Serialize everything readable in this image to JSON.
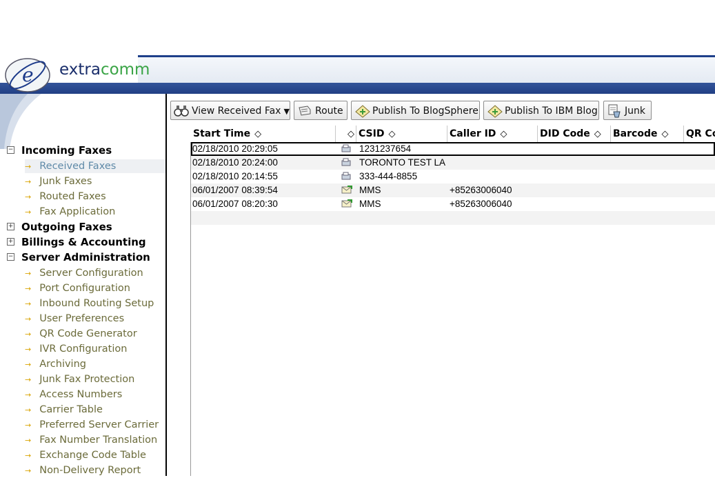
{
  "brand": {
    "part1": "extra",
    "part2": "comm"
  },
  "toolbar": {
    "view_label": "View Received Fax",
    "route_label": "Route",
    "blogsphere_label": "Publish To BlogSphere",
    "ibm_blog_label": "Publish To IBM Blog",
    "junk_label": "Junk"
  },
  "nav": {
    "incoming": {
      "label": "Incoming Faxes",
      "toggle": "−",
      "items": [
        "Received Faxes",
        "Junk Faxes",
        "Routed Faxes",
        "Fax Application"
      ]
    },
    "outgoing": {
      "label": "Outgoing Faxes",
      "toggle": "+"
    },
    "billings": {
      "label": "Billings & Accounting",
      "toggle": "+"
    },
    "server": {
      "label": "Server Administration",
      "toggle": "−",
      "items": [
        "Server Configuration",
        "Port Configuration",
        "Inbound Routing Setup",
        "User Preferences",
        "QR Code Generator",
        "IVR Configuration",
        "Archiving",
        "Junk Fax Protection",
        "Access Numbers",
        "Carrier Table",
        "Preferred Server Carrier",
        "Fax Number Translation",
        "Exchange Code Table",
        "Non-Delivery Report"
      ]
    },
    "arrow": "→",
    "active_item": "Received Faxes"
  },
  "grid": {
    "sort_glyph": "◇",
    "columns": [
      "Start Time",
      "CSID",
      "Caller ID",
      "DID Code",
      "Barcode",
      "QR Co"
    ],
    "rows": [
      {
        "start_time": "02/18/2010 20:29:05",
        "icon": "fax-icon",
        "csid": "1231237654",
        "caller_id": ""
      },
      {
        "start_time": "02/18/2010 20:24:00",
        "icon": "fax-icon",
        "csid": "TORONTO TEST LA",
        "caller_id": ""
      },
      {
        "start_time": "02/18/2010 20:14:55",
        "icon": "fax-icon",
        "csid": "333-444-8855",
        "caller_id": ""
      },
      {
        "start_time": "06/01/2007 08:39:54",
        "icon": "mms-envelope-icon",
        "csid": "MMS",
        "caller_id": "+85263006040"
      },
      {
        "start_time": "06/01/2007 08:20:30",
        "icon": "mms-envelope-icon",
        "csid": "MMS",
        "caller_id": "+85263006040"
      }
    ]
  },
  "colors": {
    "header_navy": "#213f84",
    "brand_green": "#3aa446",
    "nav_text": "#6b6b3a",
    "nav_active": "#5f8aa8"
  }
}
